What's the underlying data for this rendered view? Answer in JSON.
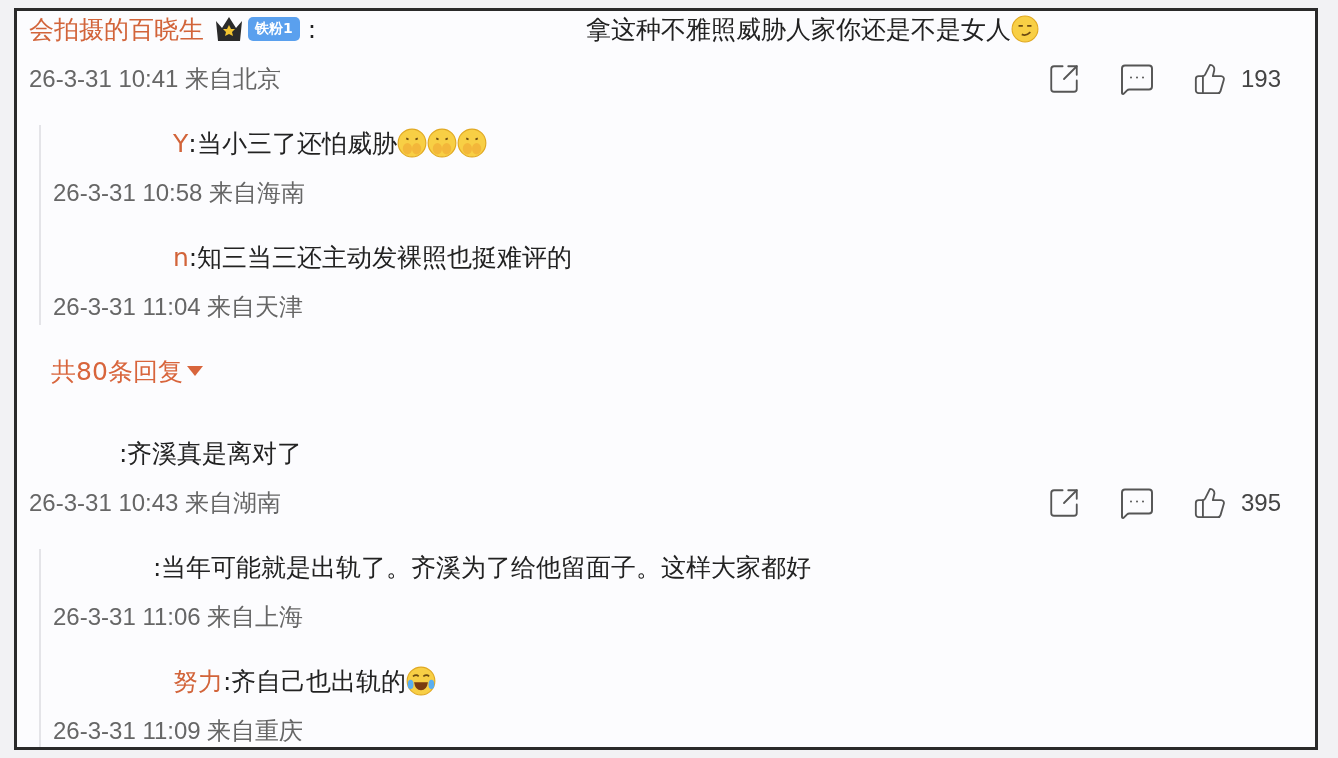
{
  "comments": [
    {
      "name": "会拍摄的百晓生",
      "crown": true,
      "badge": "铁粉1",
      "text": ":",
      "text_after_blur": "拿这种不雅照威胁人家你还是不是女人",
      "emojis": [
        {
          "kind": "smirk"
        }
      ],
      "time": "26-3-31 10:41 来自北京",
      "likes": "193",
      "replies": [
        {
          "name": "Y",
          "text": ":当小三了还怕威胁",
          "emojis": [
            {
              "kind": "hush"
            },
            {
              "kind": "hush"
            },
            {
              "kind": "hush"
            }
          ],
          "time": "26-3-31 10:58 来自海南"
        },
        {
          "name": "n",
          "text": ":知三当三还主动发裸照也挺难评的",
          "time": "26-3-31 11:04 来自天津"
        }
      ],
      "more_replies": "共80条回复"
    },
    {
      "text": ":齐溪真是离对了",
      "time": "26-3-31 10:43 来自湖南",
      "likes": "395",
      "replies": [
        {
          "text": ":当年可能就是出轨了。齐溪为了给他留面子。这样大家都好",
          "time": "26-3-31 11:06 来自上海"
        },
        {
          "name": "努力",
          "text": ":齐自己也出轨的",
          "emojis": [
            {
              "kind": "laugh"
            }
          ],
          "time": "26-3-31 11:09 来自重庆"
        }
      ]
    }
  ]
}
